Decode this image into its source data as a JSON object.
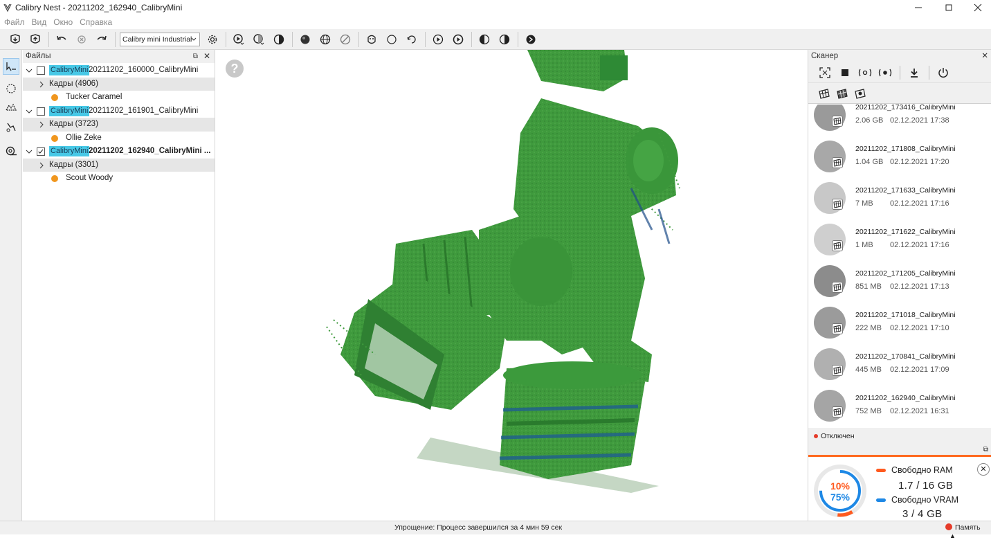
{
  "window": {
    "title": "Calibry Nest - 20211202_162940_CalibryMini"
  },
  "menu": [
    "Файл",
    "Вид",
    "Окно",
    "Справка"
  ],
  "toolbar": {
    "scanner_model": "Calibry mini Industrial"
  },
  "files_panel": {
    "title": "Файлы",
    "groups": [
      {
        "tag": "CalibryMini",
        "name": "20211202_160000_CalibryMini",
        "checked": false,
        "bold": false,
        "frames": "Кадры (4906)",
        "person": "Tucker Caramel"
      },
      {
        "tag": "CalibryMini",
        "name": "20211202_161901_CalibryMini",
        "checked": false,
        "bold": false,
        "frames": "Кадры (3723)",
        "person": "Ollie Zeke"
      },
      {
        "tag": "CalibryMini",
        "name": "20211202_162940_CalibryMini ...",
        "checked": true,
        "bold": true,
        "frames": "Кадры (3301)",
        "person": "Scout Woody"
      }
    ]
  },
  "viewport": {
    "help": "?"
  },
  "scanner_panel": {
    "title": "Сканер",
    "scans": [
      {
        "name": "20211202_173416_CalibryMini",
        "size": "2.06 GB",
        "date": "02.12.2021 17:38"
      },
      {
        "name": "20211202_171808_CalibryMini",
        "size": "1.04 GB",
        "date": "02.12.2021 17:20"
      },
      {
        "name": "20211202_171633_CalibryMini",
        "size": "7 MB",
        "date": "02.12.2021 17:16"
      },
      {
        "name": "20211202_171622_CalibryMini",
        "size": "1 MB",
        "date": "02.12.2021 17:16"
      },
      {
        "name": "20211202_171205_CalibryMini",
        "size": "851 MB",
        "date": "02.12.2021 17:13"
      },
      {
        "name": "20211202_171018_CalibryMini",
        "size": "222 MB",
        "date": "02.12.2021 17:10"
      },
      {
        "name": "20211202_170841_CalibryMini",
        "size": "445 MB",
        "date": "02.12.2021 17:09"
      },
      {
        "name": "20211202_162940_CalibryMini",
        "size": "752 MB",
        "date": "02.12.2021 16:31"
      }
    ],
    "status": "Отключен"
  },
  "memory": {
    "ram_percent": "10%",
    "vram_percent": "75%",
    "ram_label": "Свободно RAM",
    "ram_value": "1.7  / 16 GB",
    "vram_label": "Свободно VRAM",
    "vram_value": "3   / 4 GB",
    "ram_color": "#ff5a1f",
    "vram_color": "#1e88e5"
  },
  "statusbar": {
    "message": "Упрощение: Процесс завершился за 4 мин 59 сек",
    "memory_label": "Память"
  }
}
